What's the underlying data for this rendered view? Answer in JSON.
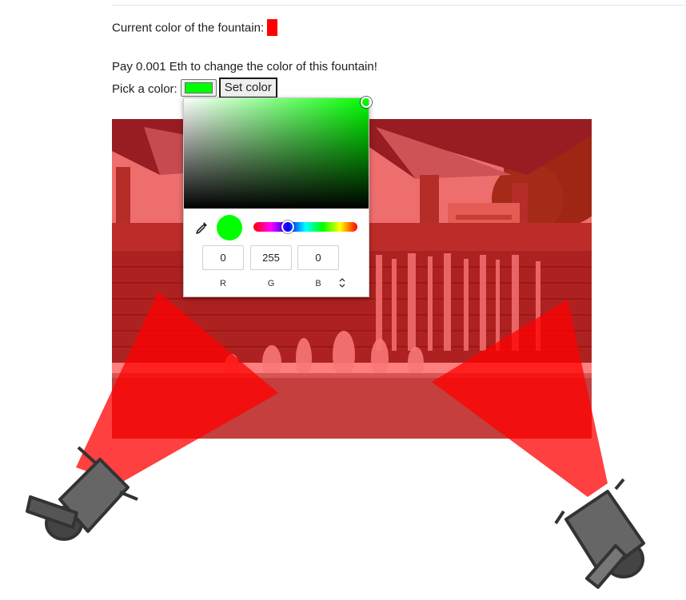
{
  "header": {
    "current_color_label": "Current color of the fountain:",
    "current_color": "#ff0000"
  },
  "payment": {
    "message": "Pay 0.001 Eth to change the color of this fountain!",
    "pick_label": "Pick a color:",
    "picked_color": "#00ff00",
    "set_button_label": "Set color"
  },
  "picker": {
    "hue_color": "#00ff00",
    "preview_color": "#00ff00",
    "hue_fraction": 0.333,
    "r_value": "0",
    "g_value": "255",
    "b_value": "0",
    "r_label": "R",
    "g_label": "G",
    "b_label": "B",
    "icons": [
      "eyedropper-icon",
      "mode-toggle-icon"
    ]
  },
  "scene": {
    "overlay_color": "#ff0000",
    "beam_color": "#ff0000",
    "icons": [
      "spotlight-left-icon",
      "spotlight-right-icon"
    ]
  }
}
